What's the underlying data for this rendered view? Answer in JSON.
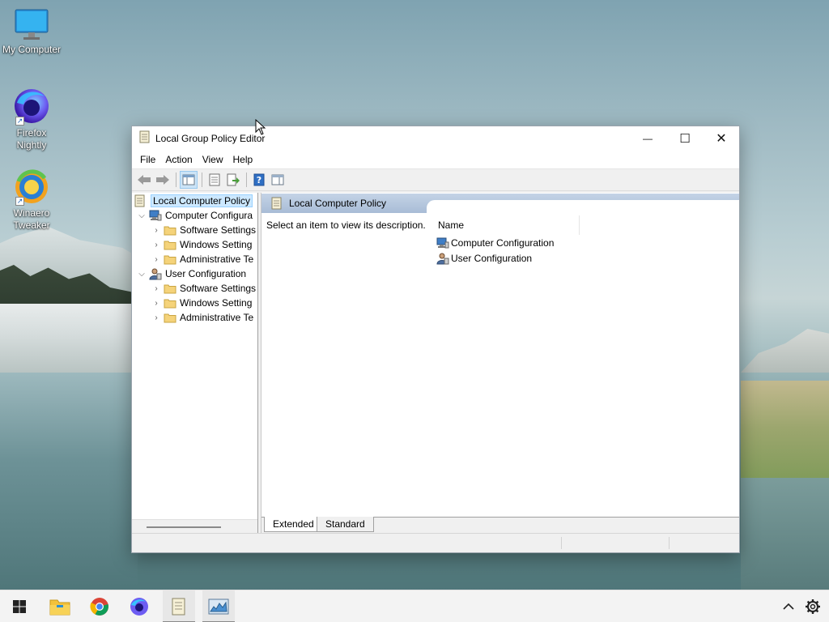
{
  "desktop": {
    "icons": [
      {
        "label": "My Computer",
        "icon": "monitor-icon"
      },
      {
        "label": "Firefox Nightly",
        "icon": "firefox-nightly-icon"
      },
      {
        "label": "Winaero Tweaker",
        "icon": "winaero-tweaker-icon"
      }
    ]
  },
  "window": {
    "title": "Local Group Policy Editor",
    "controls": {
      "minimize": "—",
      "maximize": "☐",
      "close": "✕"
    },
    "menu": [
      "File",
      "Action",
      "View",
      "Help"
    ],
    "toolbar": [
      "back-arrow-icon",
      "forward-arrow-icon",
      "show-hide-tree-icon",
      "properties-icon",
      "export-list-icon",
      "help-icon",
      "show-hide-action-pane-icon"
    ]
  },
  "tree": {
    "root": "Local Computer Policy",
    "nodes": [
      {
        "label": "Computer Configura",
        "expanded": true,
        "children": [
          "Software Settings",
          "Windows Setting",
          "Administrative Te"
        ]
      },
      {
        "label": "User Configuration",
        "expanded": true,
        "children": [
          "Software Settings",
          "Windows Setting",
          "Administrative Te"
        ]
      }
    ]
  },
  "details": {
    "header": "Local Computer Policy",
    "description": "Select an item to view its description.",
    "column_name": "Name",
    "items": [
      "Computer Configuration",
      "User Configuration"
    ]
  },
  "tabs": {
    "extended": "Extended",
    "standard": "Standard"
  },
  "taskbar": {
    "items": [
      "start-icon",
      "file-explorer-icon",
      "chrome-icon",
      "firefox-nightly-icon",
      "group-policy-icon",
      "resource-monitor-icon"
    ],
    "tray": [
      "chevron-up-icon",
      "settings-gear-icon"
    ]
  },
  "colors": {
    "accent": "#0078d4",
    "selection": "#cce8ff",
    "header_band": "#a8bcd6"
  }
}
